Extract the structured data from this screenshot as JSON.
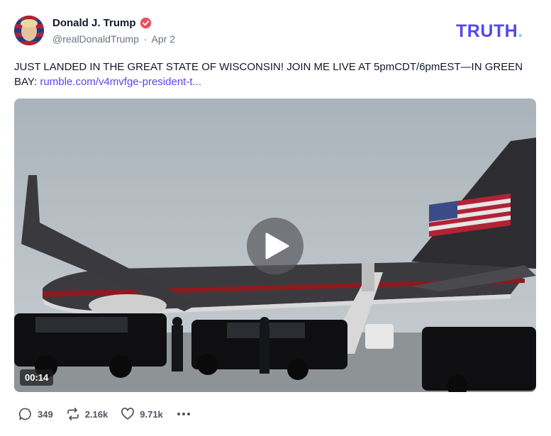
{
  "author": {
    "name": "Donald J. Trump",
    "handle": "@realDonaldTrump",
    "separator": "·",
    "date": "Apr 2"
  },
  "brand": {
    "logo_text": "TRUTH",
    "logo_dot": ".",
    "accent": "#5448ee",
    "dot_color": "#5fe0d4"
  },
  "post": {
    "text": "JUST LANDED IN THE GREAT STATE OF WISCONSIN! JOIN ME LIVE AT 5pmCDT/6pmEST—IN GREEN BAY: ",
    "link_text": "rumble.com/v4mvfge-president-t..."
  },
  "media": {
    "type": "video",
    "duration": "00:14"
  },
  "actions": {
    "replies": "349",
    "retruths": "2.16k",
    "likes": "9.71k"
  },
  "icons": [
    "verified-icon",
    "play-icon",
    "reply-icon",
    "retruth-icon",
    "like-icon",
    "more-icon"
  ]
}
